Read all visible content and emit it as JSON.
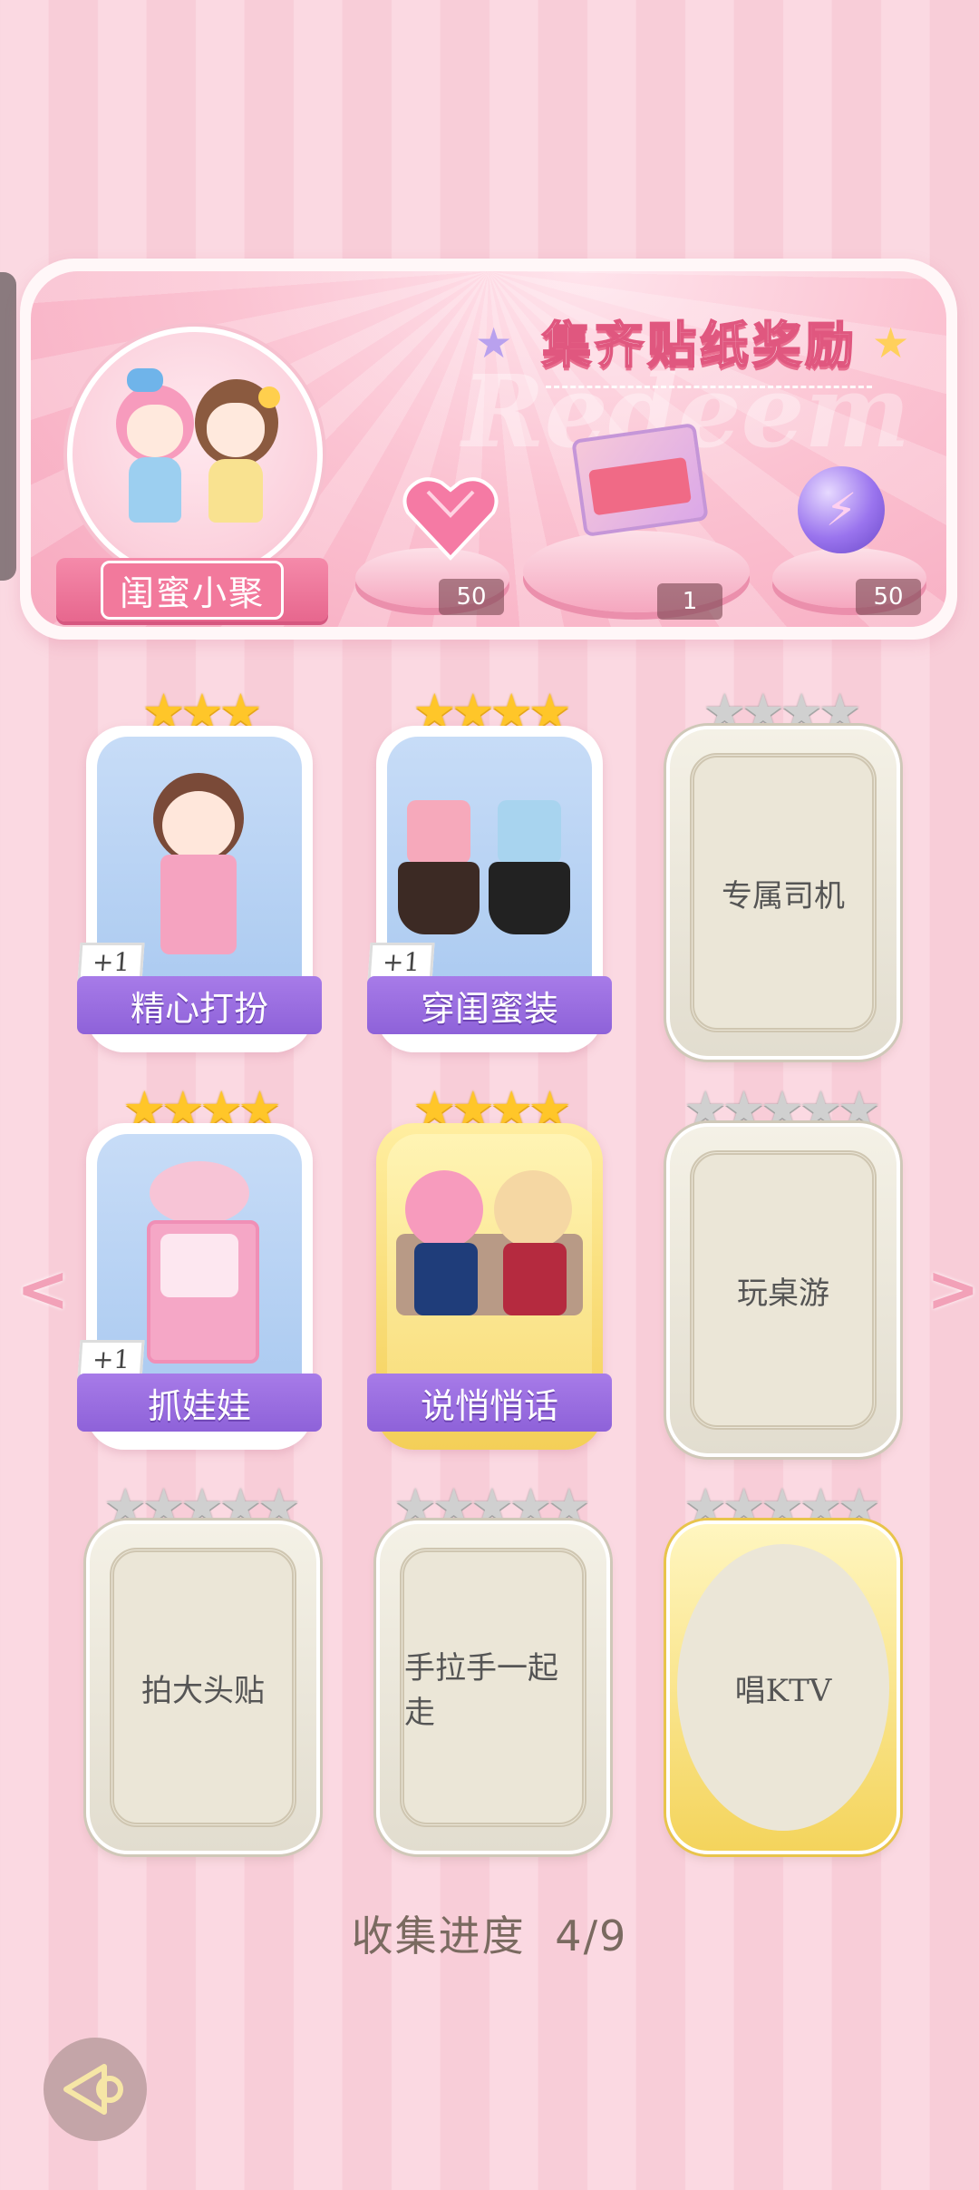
{
  "banner": {
    "title": "集齐贴纸奖励",
    "watermark": "Redeem",
    "album_name": "闺蜜小聚",
    "rewards": [
      {
        "icon": "pink-diamond-icon",
        "count": "50"
      },
      {
        "icon": "gift-box-icon",
        "count": "1"
      },
      {
        "icon": "energy-orb-icon",
        "count": "50"
      }
    ]
  },
  "stickers": [
    {
      "label": "精心打扮",
      "stars": 3,
      "max_stars": 3,
      "collected": true,
      "badge": "+1",
      "frame": "normal"
    },
    {
      "label": "穿闺蜜装",
      "stars": 4,
      "max_stars": 4,
      "collected": true,
      "badge": "+1",
      "frame": "normal"
    },
    {
      "label": "专属司机",
      "stars": 0,
      "max_stars": 4,
      "collected": false,
      "frame": "normal"
    },
    {
      "label": "抓娃娃",
      "stars": 4,
      "max_stars": 4,
      "collected": true,
      "badge": "+1",
      "frame": "normal"
    },
    {
      "label": "说悄悄话",
      "stars": 4,
      "max_stars": 4,
      "collected": true,
      "frame": "gold"
    },
    {
      "label": "玩桌游",
      "stars": 0,
      "max_stars": 5,
      "collected": false,
      "frame": "normal"
    },
    {
      "label": "拍大头贴",
      "stars": 0,
      "max_stars": 5,
      "collected": false,
      "frame": "normal"
    },
    {
      "label": "手拉手一起走",
      "stars": 0,
      "max_stars": 5,
      "collected": false,
      "frame": "normal"
    },
    {
      "label": "唱KTV",
      "stars": 0,
      "max_stars": 5,
      "collected": false,
      "frame": "gold"
    }
  ],
  "progress": {
    "label": "收集进度",
    "value": "4/9"
  },
  "colors": {
    "accent": "#8e62d9",
    "star_gold": "#ffc629",
    "star_gray": "#d0d0d0",
    "banner_pink": "#f7a9bf"
  }
}
